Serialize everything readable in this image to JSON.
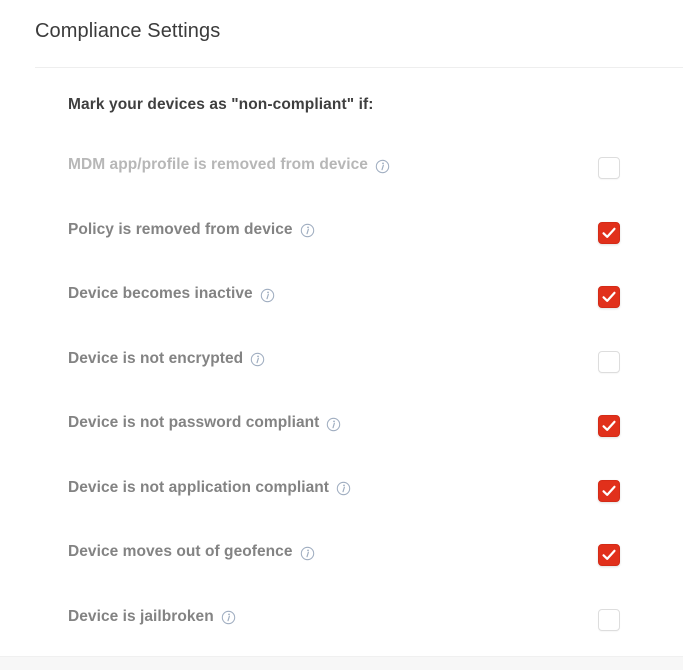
{
  "header": {
    "title": "Compliance Settings"
  },
  "section": {
    "subtitle": "Mark your devices as \"non-compliant\" if:"
  },
  "colors": {
    "checkbox_checked": "#e1301b",
    "checkbox_unchecked_border": "#dddddd",
    "label": "#838383",
    "label_disabled": "#b7b7b7",
    "title": "#3b3b3b",
    "divider": "#eeeeee",
    "info_icon": "#9fadc0"
  },
  "rules": [
    {
      "label": "MDM app/profile is removed from device",
      "checked": false,
      "disabled": true,
      "info_icon": "info-circle-icon",
      "checkbox_state": "unchecked"
    },
    {
      "label": "Policy is removed from device",
      "checked": true,
      "disabled": false,
      "info_icon": "info-circle-icon",
      "checkbox_state": "checked"
    },
    {
      "label": "Device becomes inactive",
      "checked": true,
      "disabled": false,
      "info_icon": "info-circle-icon",
      "checkbox_state": "checked"
    },
    {
      "label": "Device is not encrypted",
      "checked": false,
      "disabled": false,
      "info_icon": "info-circle-icon",
      "checkbox_state": "unchecked"
    },
    {
      "label": "Device is not password compliant",
      "checked": true,
      "disabled": false,
      "info_icon": "info-circle-icon",
      "checkbox_state": "checked"
    },
    {
      "label": "Device is not application compliant",
      "checked": true,
      "disabled": false,
      "info_icon": "info-circle-icon",
      "checkbox_state": "checked"
    },
    {
      "label": "Device moves out of geofence",
      "checked": true,
      "disabled": false,
      "info_icon": "info-circle-icon",
      "checkbox_state": "checked"
    },
    {
      "label": "Device is jailbroken",
      "checked": false,
      "disabled": false,
      "info_icon": "info-circle-icon",
      "checkbox_state": "unchecked"
    }
  ]
}
